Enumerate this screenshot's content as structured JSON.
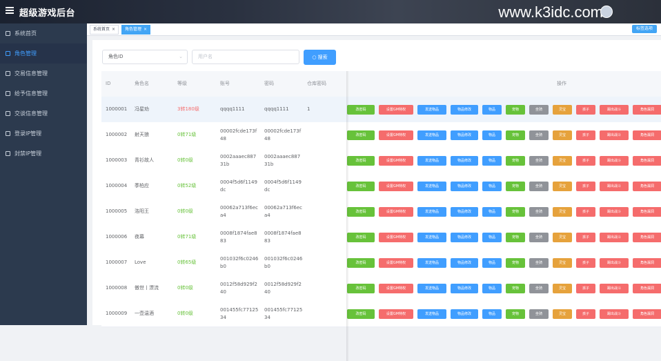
{
  "header": {
    "title": "超级游戏后台",
    "watermark": "www.k3idc.com"
  },
  "sidebar": {
    "items": [
      {
        "label": "系统首页",
        "active": false
      },
      {
        "label": "角色管理",
        "active": true
      },
      {
        "label": "交易信息管理",
        "active": false
      },
      {
        "label": "给予信息管理",
        "active": false
      },
      {
        "label": "交谈信息管理",
        "active": false
      },
      {
        "label": "登录IP管理",
        "active": false
      },
      {
        "label": "封禁IP管理",
        "active": false
      }
    ]
  },
  "tabs": {
    "items": [
      {
        "label": "系统首页",
        "close": "×"
      },
      {
        "label": "角色管理",
        "close": "×"
      }
    ],
    "right_button": "标签选项"
  },
  "search": {
    "select_value": "角色ID",
    "input_placeholder": "用户名",
    "button_label": "搜索",
    "search_glyph": "○"
  },
  "table": {
    "columns": [
      "ID",
      "角色名",
      "等级",
      "账号",
      "密码",
      "仓库密码",
      "操作"
    ],
    "rows": [
      {
        "id": "1000001",
        "name": "冯星劝",
        "grade": "3转180级",
        "grade_red": true,
        "account": "qqqq1111",
        "password": "qqqq1111",
        "store_pwd": "1"
      },
      {
        "id": "1000002",
        "name": "射天狼",
        "grade": "0转71级",
        "grade_red": false,
        "account": "00002fcde173f48",
        "password": "00002fcde173f48",
        "store_pwd": ""
      },
      {
        "id": "1000003",
        "name": "青衫故人",
        "grade": "0转0级",
        "grade_red": false,
        "account": "0002aaaec88731b",
        "password": "0002aaaec88731b",
        "store_pwd": ""
      },
      {
        "id": "1000004",
        "name": "季柏应",
        "grade": "0转52级",
        "grade_red": false,
        "account": "0004f5d6f1149dc",
        "password": "0004f5d6f1149dc",
        "store_pwd": ""
      },
      {
        "id": "1000005",
        "name": "洛阳王",
        "grade": "0转0级",
        "grade_red": false,
        "account": "00062a713f6eca4",
        "password": "00062a713f6eca4",
        "store_pwd": ""
      },
      {
        "id": "1000006",
        "name": "夜幕",
        "grade": "0转71级",
        "grade_red": false,
        "account": "0008f1874fae883",
        "password": "0008f1874fae883",
        "store_pwd": ""
      },
      {
        "id": "1000007",
        "name": "Love",
        "grade": "0转65级",
        "grade_red": false,
        "account": "001032f6c0246b0",
        "password": "001032f6c0246b0",
        "store_pwd": ""
      },
      {
        "id": "1000008",
        "name": "傲世丨漂流",
        "grade": "0转0级",
        "grade_red": false,
        "account": "0012f58d929f240",
        "password": "0012f58d929f240",
        "store_pwd": ""
      },
      {
        "id": "1000009",
        "name": "一壶温酒",
        "grade": "0转0级",
        "grade_red": false,
        "account": "001455fc7712534",
        "password": "001455fc7712534",
        "store_pwd": ""
      }
    ],
    "actions": [
      {
        "label": "改密码",
        "color": "#67c23a"
      },
      {
        "label": "设置GM特权",
        "color": "#f56c6c"
      },
      {
        "label": "发送物品",
        "color": "#409eff"
      },
      {
        "label": "物品修改",
        "color": "#409eff"
      },
      {
        "label": "物品",
        "color": "#409eff"
      },
      {
        "label": "宠物",
        "color": "#67c23a"
      },
      {
        "label": "坐骑",
        "color": "#909399"
      },
      {
        "label": "灵宝",
        "color": "#e6a23c"
      },
      {
        "label": "孩子",
        "color": "#f56c6c"
      },
      {
        "label": "踢出战斗",
        "color": "#f56c6c"
      },
      {
        "label": "角色漏洞",
        "color": "#f56c6c"
      }
    ]
  }
}
